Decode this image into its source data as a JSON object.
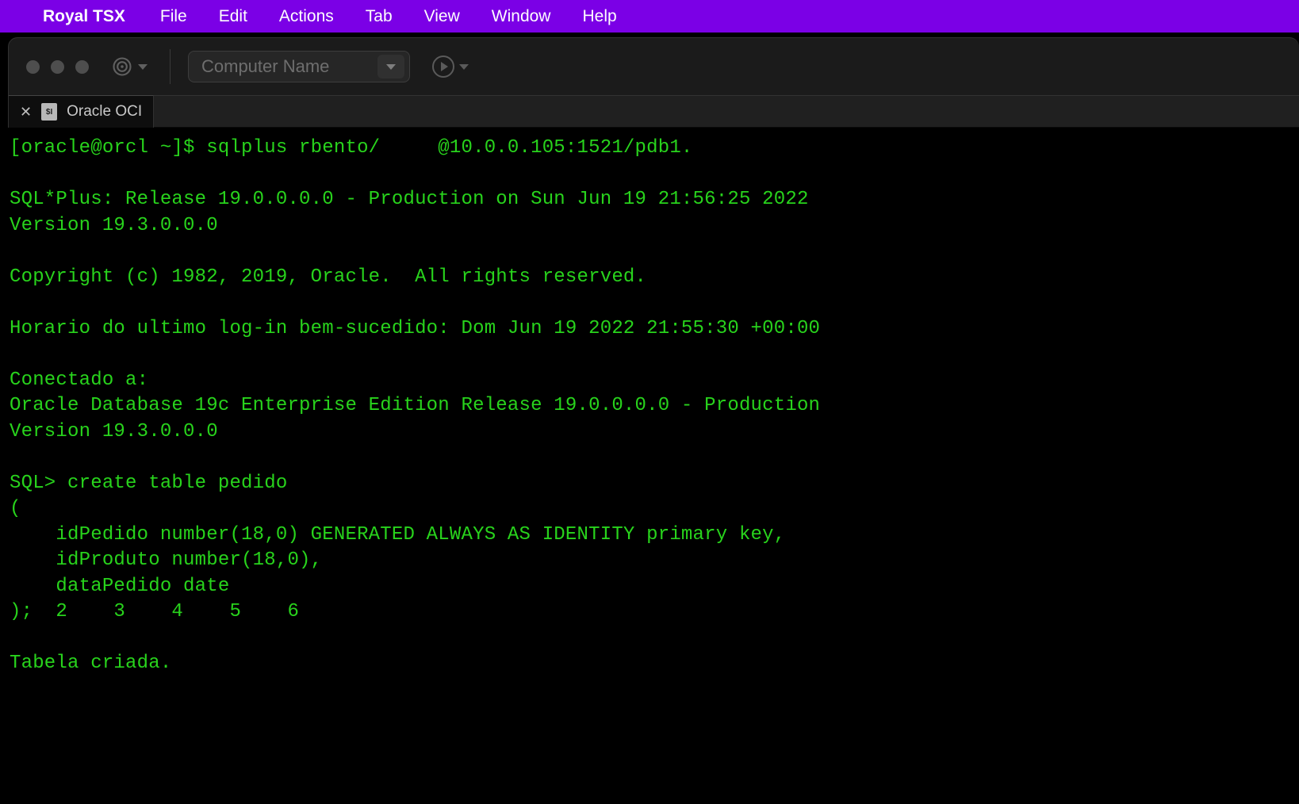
{
  "menubar": {
    "apple_glyph": "",
    "app_name": "Royal TSX",
    "items": [
      "File",
      "Edit",
      "Actions",
      "Tab",
      "View",
      "Window",
      "Help"
    ]
  },
  "toolbar": {
    "address_placeholder": "Computer Name"
  },
  "tab": {
    "label": "Oracle OCI",
    "close_glyph": "✕",
    "doc_badge": "$I"
  },
  "terminal": {
    "lines": [
      "[oracle@orcl ~]$ sqlplus rbento/     @10.0.0.105:1521/pdb1.",
      "",
      "SQL*Plus: Release 19.0.0.0.0 - Production on Sun Jun 19 21:56:25 2022",
      "Version 19.3.0.0.0",
      "",
      "Copyright (c) 1982, 2019, Oracle.  All rights reserved.",
      "",
      "Horario do ultimo log-in bem-sucedido: Dom Jun 19 2022 21:55:30 +00:00",
      "",
      "Conectado a:",
      "Oracle Database 19c Enterprise Edition Release 19.0.0.0.0 - Production",
      "Version 19.3.0.0.0",
      "",
      "SQL> create table pedido",
      "(",
      "    idPedido number(18,0) GENERATED ALWAYS AS IDENTITY primary key,",
      "    idProduto number(18,0),",
      "    dataPedido date",
      ");  2    3    4    5    6  ",
      "",
      "Tabela criada."
    ]
  }
}
